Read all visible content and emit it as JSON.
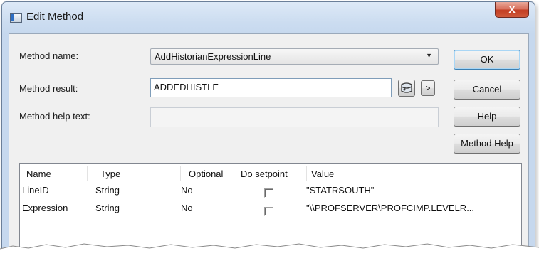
{
  "window": {
    "title": "Edit Method",
    "close_glyph": "X"
  },
  "form": {
    "method_name_label": "Method name:",
    "method_name_value": "AddHistorianExpressionLine",
    "method_result_label": "Method result:",
    "method_result_value": "ADDEDHISTLE",
    "method_help_label": "Method help text:",
    "method_help_value": "",
    "browse_glyph": ">"
  },
  "buttons": {
    "ok": "OK",
    "cancel": "Cancel",
    "help": "Help",
    "method_help": "Method Help"
  },
  "params": {
    "columns": [
      "Name",
      "Type",
      "Optional",
      "Do setpoint",
      "Value"
    ],
    "rows": [
      {
        "name": "LineID",
        "type": "String",
        "optional": "No",
        "setpoint": false,
        "value": "\"STATRSOUTH\""
      },
      {
        "name": "Expression",
        "type": "String",
        "optional": "No",
        "setpoint": false,
        "value": "\"\\\\PROFSERVER\\PROFCIMP.LEVELR..."
      }
    ]
  }
}
